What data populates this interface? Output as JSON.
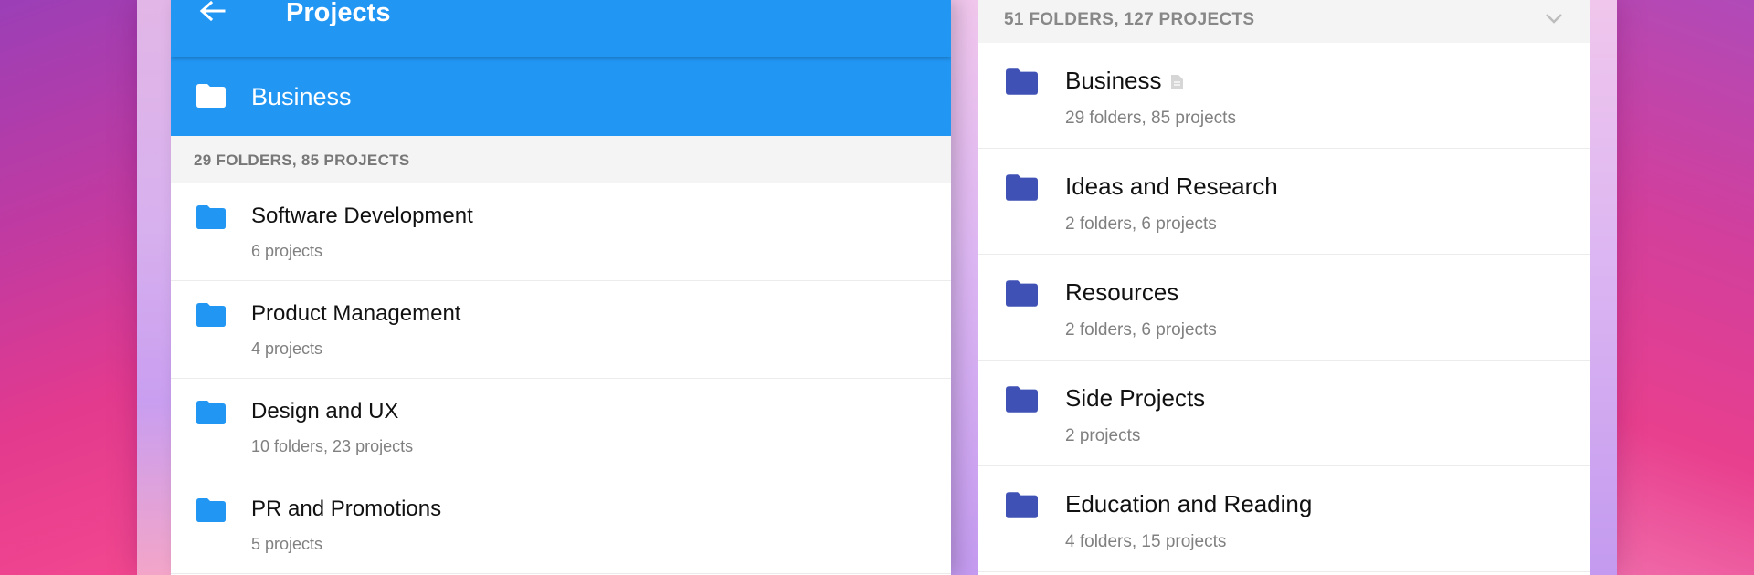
{
  "appbar": {
    "title": "Projects"
  },
  "current_folder": {
    "name": "Business"
  },
  "left_summary": "29 FOLDERS, 85 PROJECTS",
  "left_items": [
    {
      "title": "Software Development",
      "subtitle": "6 projects"
    },
    {
      "title": "Product Management",
      "subtitle": "4 projects"
    },
    {
      "title": "Design and UX",
      "subtitle": "10 folders, 23 projects"
    },
    {
      "title": "PR and Promotions",
      "subtitle": "5 projects"
    }
  ],
  "right_summary": "51 FOLDERS, 127 PROJECTS",
  "right_items": [
    {
      "title": "Business",
      "subtitle": "29 folders, 85 projects",
      "has_note": true
    },
    {
      "title": "Ideas and Research",
      "subtitle": "2 folders, 6 projects"
    },
    {
      "title": "Resources",
      "subtitle": "2 folders, 6 projects"
    },
    {
      "title": "Side Projects",
      "subtitle": "2 projects"
    },
    {
      "title": "Education and Reading",
      "subtitle": "4 folders, 15 projects"
    }
  ],
  "colors": {
    "primary": "#2196f3",
    "folder_light": "#2196f3",
    "folder_dark": "#3f51b5"
  },
  "icons": {
    "back": "arrow-left-icon",
    "folder": "folder-icon",
    "chevron": "chevron-down-icon",
    "note": "document-icon"
  }
}
